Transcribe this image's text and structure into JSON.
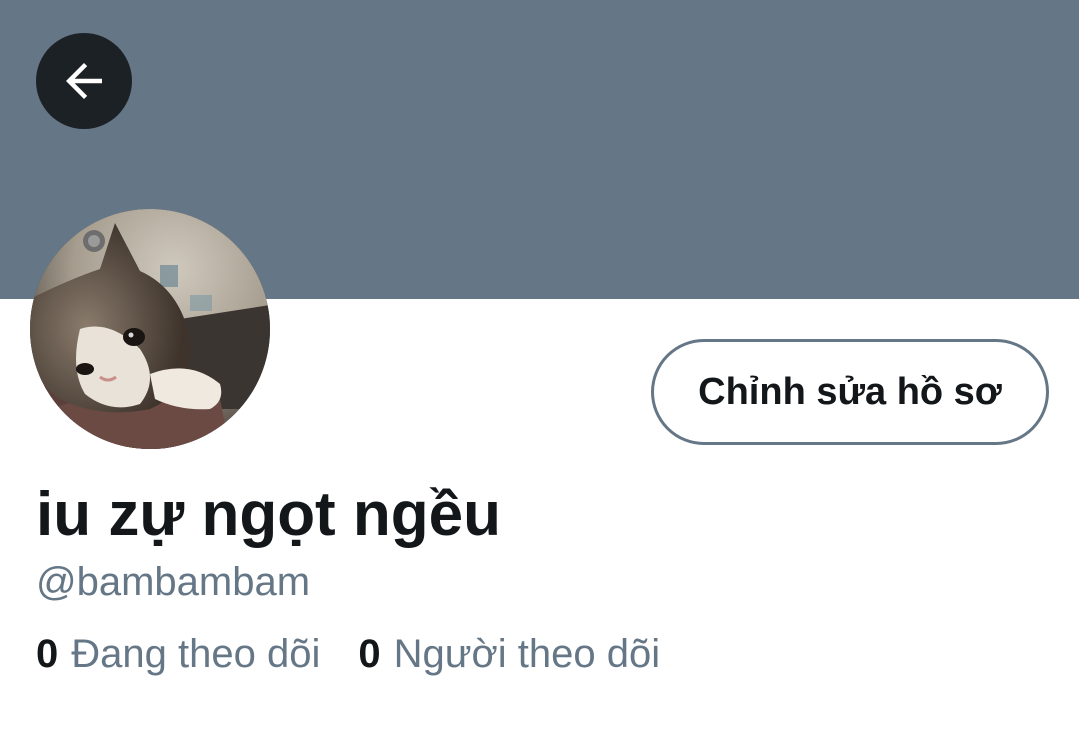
{
  "header": {
    "back_icon": "arrow-left-icon",
    "banner_color": "#657786"
  },
  "profile": {
    "avatar": "cat-photo",
    "edit_button_label": "Chỉnh sửa hồ sơ",
    "display_name": "iu zự ngọt ngều",
    "handle": "@bambambam",
    "stats": {
      "following_count": "0",
      "following_label": "Đang theo dõi",
      "followers_count": "0",
      "followers_label": "Người theo dõi"
    }
  },
  "colors": {
    "primary_text": "#14171a",
    "secondary_text": "#657786",
    "back_button_bg": "#1c2126"
  }
}
